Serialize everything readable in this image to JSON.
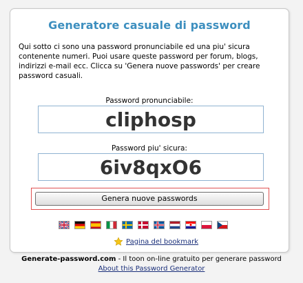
{
  "card": {
    "title": "Generatore casuale di password",
    "intro": "Qui sotto ci sono una password pronunciabile ed una piu' sicura contenente numeri. Puoi usare queste password per forum, blogs, indirizzi e-mail ecc. Clicca su 'Genera nuove passwords' per creare password casuali."
  },
  "pronounceable": {
    "label": "Password pronunciabile:",
    "value": "cliphosp"
  },
  "secure": {
    "label": "Password piu' sicura:",
    "value": "6iv8qxO6"
  },
  "generate_button": "Genera nuove passwords",
  "languages": [
    {
      "name": "english-flag-icon"
    },
    {
      "name": "german-flag-icon"
    },
    {
      "name": "spanish-flag-icon"
    },
    {
      "name": "italian-flag-icon"
    },
    {
      "name": "swedish-flag-icon"
    },
    {
      "name": "danish-flag-icon"
    },
    {
      "name": "icelandic-flag-icon"
    },
    {
      "name": "dutch-flag-icon"
    },
    {
      "name": "croatian-flag-icon"
    },
    {
      "name": "polish-flag-icon"
    },
    {
      "name": "czech-flag-icon"
    }
  ],
  "bookmark_link": "Pagina del bookmark",
  "footer": {
    "site": "Generate-password.com",
    "tagline": " - Il toon on-line gratuito per generare password",
    "about_link": "About this Password Generator"
  }
}
